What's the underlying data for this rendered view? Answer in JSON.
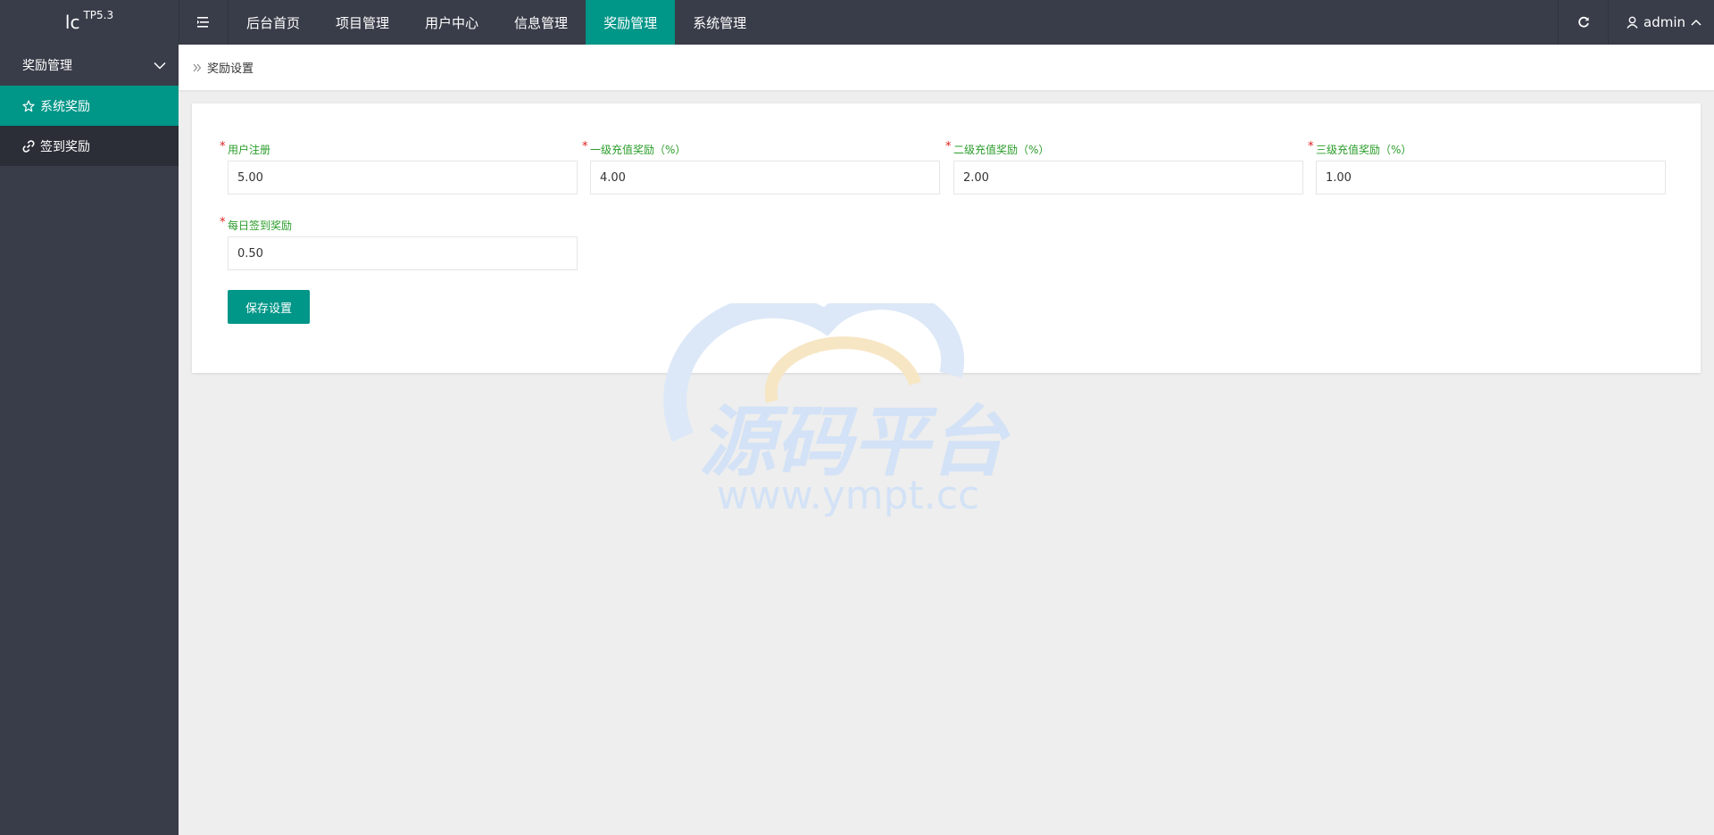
{
  "logo": {
    "main": "lc",
    "sup": "TP5.3"
  },
  "top_nav": [
    {
      "label": "后台首页",
      "active": false
    },
    {
      "label": "项目管理",
      "active": false
    },
    {
      "label": "用户中心",
      "active": false
    },
    {
      "label": "信息管理",
      "active": false
    },
    {
      "label": "奖励管理",
      "active": true
    },
    {
      "label": "系统管理",
      "active": false
    }
  ],
  "header": {
    "user": "admin"
  },
  "sidebar": {
    "group_label": "奖励管理",
    "items": [
      {
        "label": "系统奖励",
        "icon": "star-icon",
        "active": true
      },
      {
        "label": "签到奖励",
        "icon": "link-icon",
        "active": false
      }
    ]
  },
  "breadcrumb": {
    "current": "奖励设置"
  },
  "form": {
    "fields": [
      {
        "label": "用户注册",
        "value": "5.00"
      },
      {
        "label": "一级充值奖励（%）",
        "value": "4.00"
      },
      {
        "label": "二级充值奖励（%）",
        "value": "2.00"
      },
      {
        "label": "三级充值奖励（%）",
        "value": "1.00"
      },
      {
        "label": "每日签到奖励",
        "value": "0.50"
      }
    ],
    "required_mark": "*",
    "save_label": "保存设置"
  },
  "watermark": {
    "title": "源码平台",
    "url": "www.ympt.cc"
  },
  "colors": {
    "header_bg": "#393d49",
    "accent": "#009688",
    "label_green": "#2a9d2a",
    "required_red": "#e02020"
  }
}
